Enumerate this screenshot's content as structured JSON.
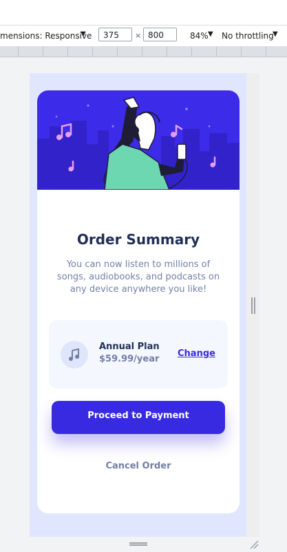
{
  "devtools": {
    "dimensions_label": "mensions: Responsive",
    "width_value": "375",
    "times": "×",
    "height_value": "800",
    "zoom": "84%",
    "throttling": "No throttling"
  },
  "card": {
    "title": "Order Summary",
    "description": "You can now listen to millions of songs, audiobooks, and podcasts on any device anywhere you like!",
    "plan": {
      "name": "Annual Plan",
      "price": "$59.99/year",
      "change_label": "Change"
    },
    "pay_label": "Proceed to Payment",
    "cancel_label": "Cancel Order"
  },
  "colors": {
    "accent": "#382ae1",
    "page_bg": "#e0e6fd",
    "title": "#1f2f56",
    "muted": "#717fa6"
  },
  "icons": [
    "dropdown-arrow-icon",
    "music-note-icon",
    "resize-handle-icon"
  ]
}
